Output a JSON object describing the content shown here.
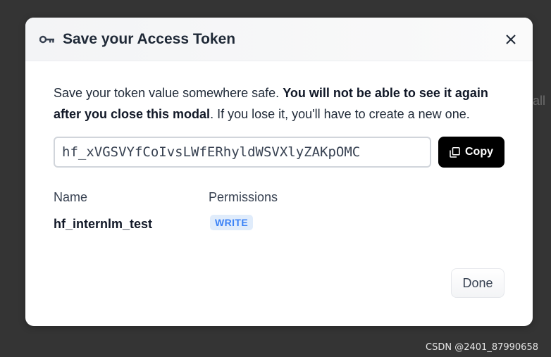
{
  "modal": {
    "title": "Save your Access Token",
    "message_start": "Save your token value somewhere safe. ",
    "message_bold": "You will not be able to see it again after you close this modal",
    "message_end": ". If you lose it, you'll have to create a new one.",
    "token_value": "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",
    "copy_label": "Copy",
    "columns": [
      "Name",
      "Permissions"
    ],
    "token_name": "hf_internlm_test",
    "permission": "WRITE",
    "done_label": "Done",
    "icons": {
      "header": "key-icon",
      "close": "close-icon",
      "copy": "copy-icon"
    }
  },
  "background": {
    "peek_text": "all"
  },
  "watermark": "CSDN @2401_87990658",
  "colors": {
    "overlay": "#343434",
    "copy_button": "#000000",
    "badge_bg": "#e0ecfb",
    "badge_text": "#3b82f6"
  }
}
